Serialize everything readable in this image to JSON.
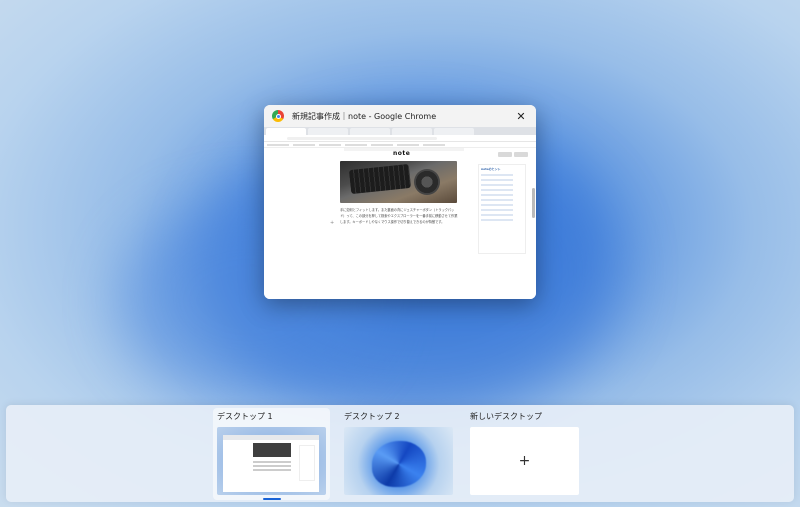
{
  "window": {
    "title": "新規記事作成｜note - Google Chrome",
    "close_glyph": "✕",
    "page": {
      "site_logo": "note",
      "article_text": "手に如何とフィットします。また裏面の背にジェスチャーボタン（トラックパッド）って、この部分を押して検索やエクスプローラーを一番手前に移動させて作業します。キーボードしやなくマウス操作で切り替えできるのが特徴です。",
      "side_panel_title": "noteのヒント",
      "add_glyph": "+"
    }
  },
  "desktops": [
    {
      "label": "デスクトップ 1",
      "active": true
    },
    {
      "label": "デスクトップ 2",
      "active": false
    },
    {
      "label": "新しいデスクトップ",
      "add_glyph": "+"
    }
  ]
}
